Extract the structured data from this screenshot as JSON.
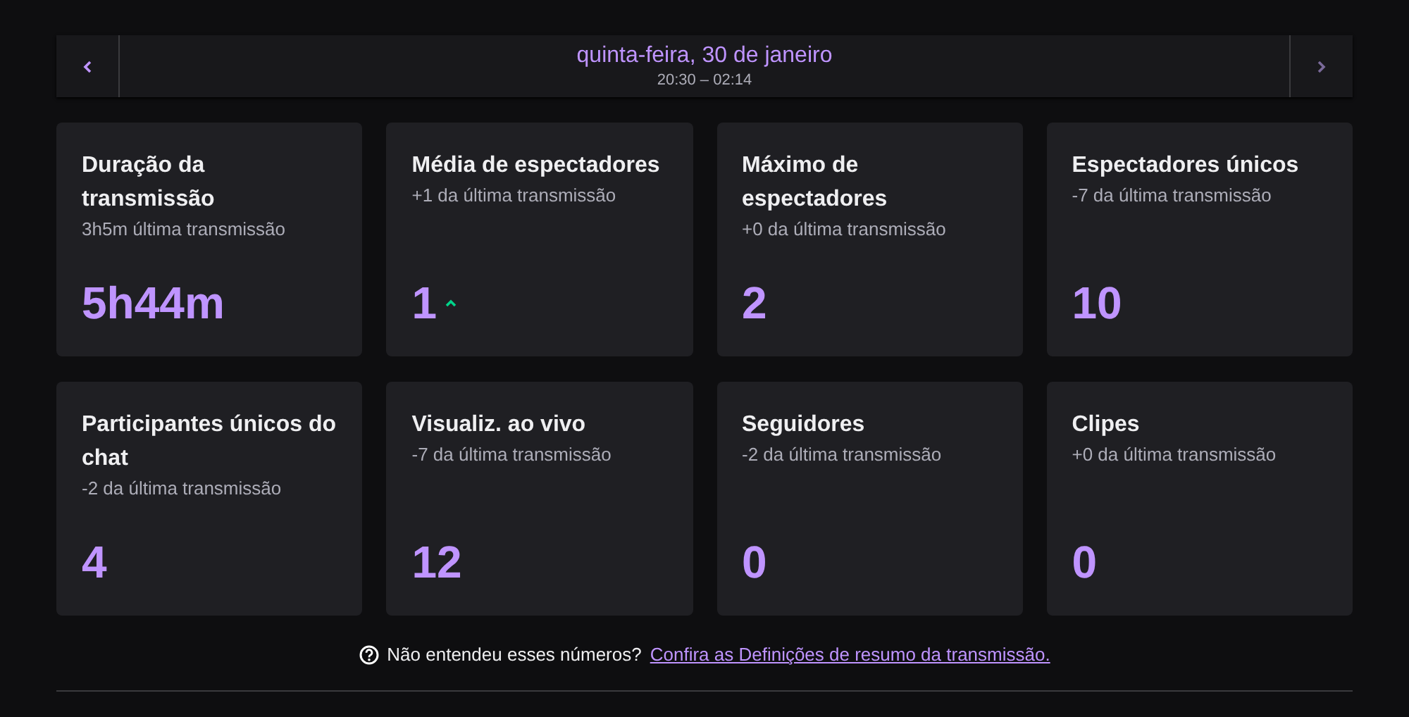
{
  "header": {
    "date": "quinta-feira, 30 de janeiro",
    "time_range": "20:30 – 02:14"
  },
  "cards": [
    {
      "title": "Duração da transmissão",
      "comparison": "3h5m última transmissão",
      "value": "5h44m",
      "rising": false
    },
    {
      "title": "Média de espectadores",
      "comparison": "+1 da última transmissão",
      "value": "1",
      "rising": true
    },
    {
      "title": "Máximo de espectadores",
      "comparison": "+0 da última transmissão",
      "value": "2",
      "rising": false
    },
    {
      "title": "Espectadores únicos",
      "comparison": "-7 da última transmissão",
      "value": "10",
      "rising": false
    },
    {
      "title": "Participantes únicos do chat",
      "comparison": "-2 da última transmissão",
      "value": "4",
      "rising": false
    },
    {
      "title": "Visualiz. ao vivo",
      "comparison": "-7 da última transmissão",
      "value": "12",
      "rising": false
    },
    {
      "title": "Seguidores",
      "comparison": "-2 da última transmissão",
      "value": "0",
      "rising": false
    },
    {
      "title": "Clipes",
      "comparison": "+0 da última transmissão",
      "value": "0",
      "rising": false
    }
  ],
  "footer": {
    "question": "Não entendeu esses números?",
    "link": "Confira as Definições de resumo da transmissão."
  }
}
